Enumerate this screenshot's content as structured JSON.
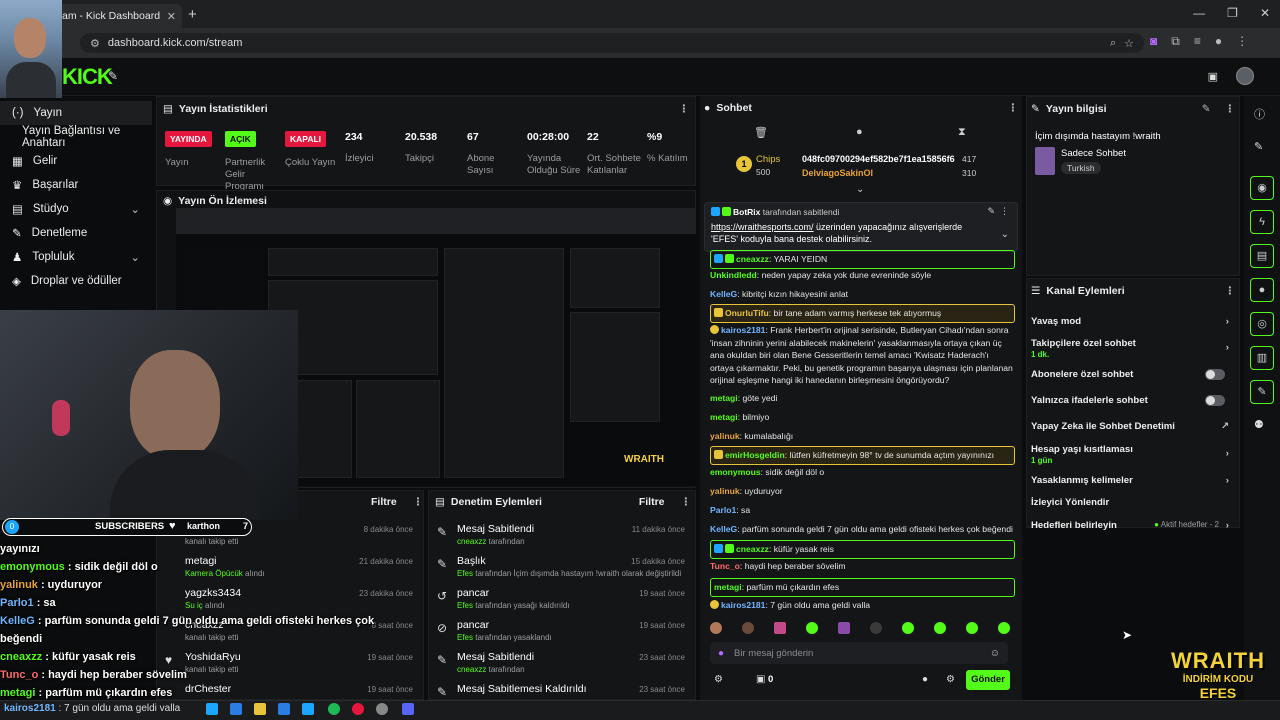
{
  "browser": {
    "tab_title": "am - Kick Dashboard",
    "url": "dashboard.kick.com/stream",
    "new_tab": "+",
    "win_min": "—",
    "win_max": "❐",
    "win_close": "✕"
  },
  "kick": {
    "logo": "KICK"
  },
  "sidebar": {
    "items": [
      {
        "label": "Yayın",
        "icon": "stream-icon"
      },
      {
        "label": "Yayın Bağlantısı ve Anahtarı",
        "icon": ""
      },
      {
        "label": "Gelir",
        "icon": "revenue-icon"
      },
      {
        "label": "Başarılar",
        "icon": "trophy-icon"
      },
      {
        "label": "Stüdyo",
        "icon": "studio-icon"
      },
      {
        "label": "Denetleme",
        "icon": "wrench-icon"
      },
      {
        "label": "Topluluk",
        "icon": "community-icon"
      },
      {
        "label": "Droplar ve ödüller",
        "icon": "drops-icon"
      }
    ]
  },
  "stats": {
    "title": "Yayın İstatistikleri",
    "live_pill": "YAYINDA",
    "live_label": "Yayın",
    "partner_pill": "AÇIK",
    "partner_label": "Partnerlik Gelir Programı",
    "multi_pill": "KAPALI",
    "multi_label": "Çoklu Yayın",
    "viewers": "234",
    "viewers_label": "İzleyici",
    "followers": "20.538",
    "followers_label": "Takipçi",
    "subs": "67",
    "subs_label": "Abone Sayısı",
    "uptime": "00:28:00",
    "uptime_label": "Yayında Olduğu Süre",
    "avg": "22",
    "avg_label": "Ort. Sohbete Katılanlar",
    "pct": "%9",
    "pct_label": "% Katılım"
  },
  "preview": {
    "title": "Yayın Ön İzlemesi"
  },
  "left_list": {
    "filter": "Filtre",
    "rows": [
      {
        "name": "karthon",
        "sub": "kanalı takip etti",
        "time": "8 dakika önce",
        "green": ""
      },
      {
        "name": "metagi",
        "sub": "alındı",
        "time": "21 dakika önce",
        "green": "Kamera Öpücük"
      },
      {
        "name": "yagzks3434",
        "sub": "alındı",
        "time": "23 dakika önce",
        "green": "Su iç"
      },
      {
        "name": "cneaxzz",
        "sub": "kanalı takip etti",
        "time": "8 saat önce",
        "green": ""
      },
      {
        "name": "YoshidaRyu",
        "sub": "kanalı takip etti",
        "time": "19 saat önce",
        "green": ""
      },
      {
        "name": "drChester",
        "sub": "",
        "time": "19 saat önce",
        "green": ""
      }
    ]
  },
  "mod_list": {
    "title": "Denetim Eylemleri",
    "filter": "Filtre",
    "rows": [
      {
        "name": "Mesaj Sabitlendi",
        "who": "cneaxzz",
        "rest": "tarafından",
        "time": "11 dakika önce"
      },
      {
        "name": "Başlık",
        "who": "Efes",
        "rest": "tarafından İçim dışımda hastayım !wraith olarak değiştirildi",
        "time": "15 dakika önce"
      },
      {
        "name": "pancar",
        "who": "Efes",
        "rest": "tarafından yasağı kaldırıldı",
        "time": "19 saat önce"
      },
      {
        "name": "pancar",
        "who": "Efes",
        "rest": "tarafından yasaklandı",
        "time": "19 saat önce"
      },
      {
        "name": "Mesaj Sabitlendi",
        "who": "cneaxzz",
        "rest": "tarafından",
        "time": "23 saat önce"
      },
      {
        "name": "Mesaj Sabitlemesi Kaldırıldı",
        "who": "",
        "rest": "",
        "time": "23 saat önce"
      }
    ]
  },
  "overlay": {
    "subs_count": "0",
    "subs_label": "SUBSCRIBERS",
    "follower_name": "karthon",
    "follower_num": "7",
    "lines": [
      {
        "user": "",
        "text": "yayınızı"
      },
      {
        "user": "emonymous",
        "text": " : sidik değil döl o"
      },
      {
        "user": "yalinuk",
        "text": " : uyduruyor"
      },
      {
        "user": "Parlo1",
        "text": " : sa"
      },
      {
        "user": "KelleG",
        "text": " : parfüm sonunda geldi 7 gün oldu ama geldi ofisteki herkes çok"
      },
      {
        "user": "",
        "text": "beğendi"
      },
      {
        "user": "cneaxzz",
        "text": " : küfür yasak reis"
      },
      {
        "user": "Tunc_o",
        "text": " : haydi hep beraber sövelim"
      },
      {
        "user": "metagi",
        "text": " : parfüm mü çıkardın efes"
      },
      {
        "user": "kairos2181",
        "text": " : 7 gün oldu ama geldi valla"
      }
    ]
  },
  "chat": {
    "title": "Sohbet",
    "chips_label": "Chips",
    "chips_value": "500",
    "hash": "048fc09700294ef582be7f1ea15856f6",
    "hash_num": "417",
    "delviago": "DelviagoSakinOl",
    "delviago_num": "310",
    "pinned_by": "BotRix",
    "pinned_suffix": "tarafından sabitlendi",
    "pinned_link": "https://wraithesports.com/",
    "pinned_text": " üzerinden yapacağınız alışverişlerde 'EFES' koduyla bana destek olabilirsiniz.",
    "messages": [
      {
        "u": "cneaxzz",
        "c": "#53fc18",
        "t": ": YARAI YEIDN"
      },
      {
        "u": "Unkindledd",
        "c": "#53fc18",
        "t": ": neden yapay zeka yok dune evreninde söyle"
      },
      {
        "u": "KelleG",
        "c": "#6fb5ff",
        "t": ": kibritçi kızın hikayesini anlat"
      },
      {
        "u": "OnurluTifu",
        "c": "#e8c43a",
        "t": ": bir tane adam varmış herkese tek atıyormuş"
      },
      {
        "u": "kairos2181",
        "c": "#6fb5ff",
        "t": ": Frank Herbert'in orijinal serisinde, Butleryan Cihadı'ndan sonra 'insan zihninin yerini alabilecek makinelerin' yasaklanmasıyla ortaya çıkan üç ana okuldan biri olan Bene Gesseritlerin temel amacı 'Kwisatz Haderach'ı ortaya çıkarmaktır. Peki, bu genetik programın başarıya ulaşması için planlanan orijinal eşleşme hangi iki hanedanın birleşmesini öngörüyordu?"
      },
      {
        "u": "metagi",
        "c": "#53fc18",
        "t": ": göte yedi"
      },
      {
        "u": "metagi",
        "c": "#53fc18",
        "t": ": bilmiyo"
      },
      {
        "u": "yalinuk",
        "c": "#e8a33a",
        "t": ": kumalabalığı"
      },
      {
        "u": "emirHosgeldin",
        "c": "#53fc18",
        "t": ": lütfen küfretmeyin 98° tv de sunumda açtım yayınınızı"
      },
      {
        "u": "emonymous",
        "c": "#53fc18",
        "t": ": sidik değil döl o"
      },
      {
        "u": "yalinuk",
        "c": "#e8a33a",
        "t": ": uyduruyor"
      },
      {
        "u": "Parlo1",
        "c": "#6fb5ff",
        "t": ": sa"
      },
      {
        "u": "KelleG",
        "c": "#6fb5ff",
        "t": ": parfüm sonunda geldi 7 gün oldu ama geldi ofisteki herkes çok beğendi"
      },
      {
        "u": "cneaxzz",
        "c": "#53fc18",
        "t": ": küfür yasak reis"
      },
      {
        "u": "Tunc_o",
        "c": "#ff6b6b",
        "t": ": haydi hep beraber sövelim"
      },
      {
        "u": "metagi",
        "c": "#53fc18",
        "t": ": parfüm mü çıkardın efes"
      },
      {
        "u": "kairos2181",
        "c": "#6fb5ff",
        "t": ": 7 gün oldu ama geldi valla"
      }
    ],
    "input_placeholder": "Bir mesaj gönderin",
    "points": "0",
    "send_label": "Gönder"
  },
  "info": {
    "title": "Yayın bilgisi",
    "stream_title": "İçim dışımda hastayım !wraith",
    "category": "Sadece Sohbet",
    "tag": "Turkish"
  },
  "actions": {
    "title": "Kanal Eylemleri",
    "items": [
      {
        "label": "Yavaş mod",
        "sub": ""
      },
      {
        "label": "Takipçilere özel sohbet",
        "sub": "1 dk."
      },
      {
        "label": "Abonelere özel sohbet",
        "sub": ""
      },
      {
        "label": "Yalnızca ifadelerle sohbet",
        "sub": ""
      },
      {
        "label": "Yapay Zeka ile Sohbet Denetimi",
        "sub": ""
      },
      {
        "label": "Hesap yaşı kısıtlaması",
        "sub": "1 gün"
      },
      {
        "label": "Yasaklanmış kelimeler",
        "sub": ""
      },
      {
        "label": "İzleyici Yönlendir",
        "sub": ""
      },
      {
        "label": "Hedefleri belirleyin",
        "sub": ""
      }
    ],
    "goals_status": "Aktif hedefler - 2"
  },
  "stream_overlay": {
    "brand": "WRAITH",
    "promo": "İNDİRİM KODU",
    "code": "EFES"
  },
  "colors": {
    "kick_green": "#53fc18",
    "live_red": "#e5173f",
    "panel": "#141517"
  }
}
